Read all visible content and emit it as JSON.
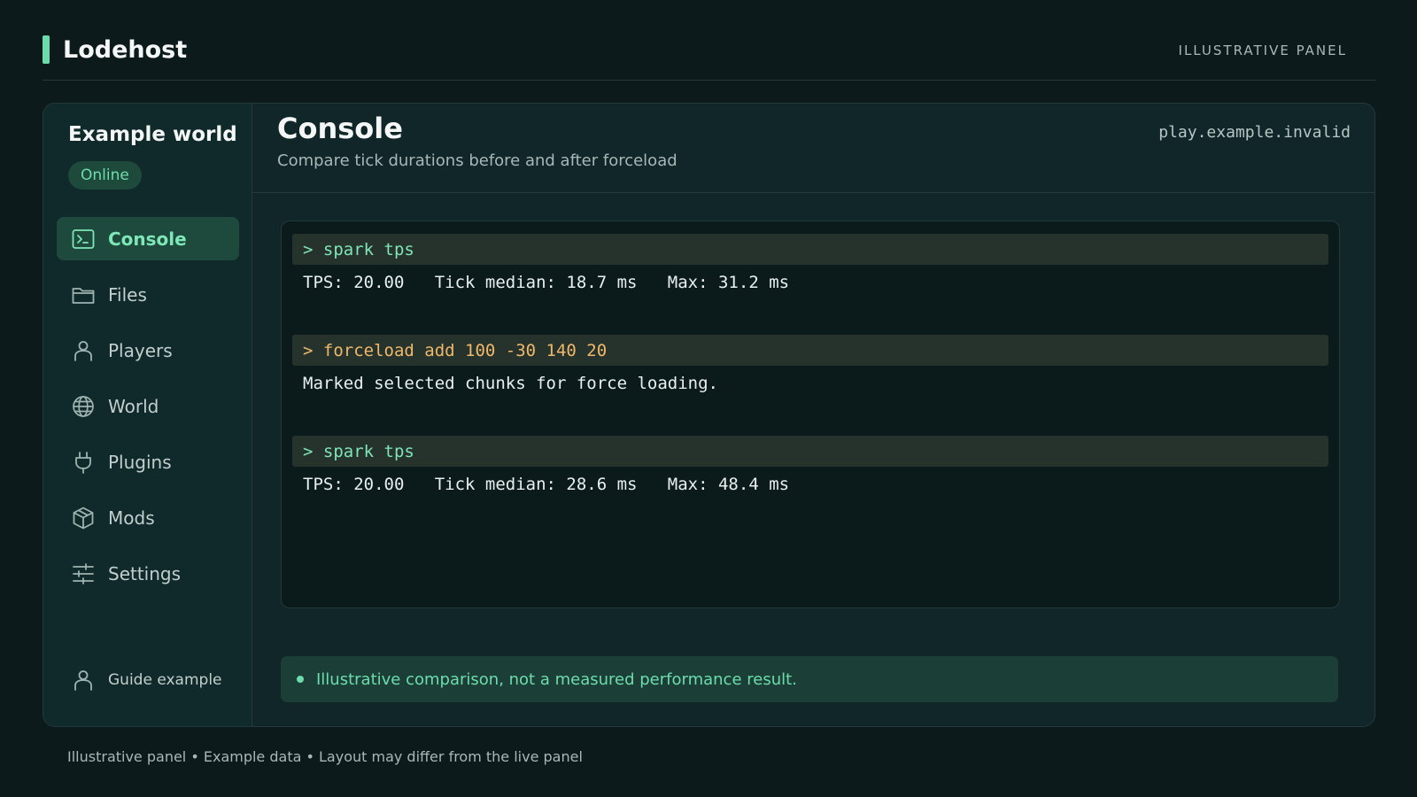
{
  "app": {
    "brand": "Lodehost",
    "top_label": "ILLUSTRATIVE PANEL"
  },
  "sidebar": {
    "world_title": "Example world",
    "status": "Online",
    "items": [
      {
        "label": "Console",
        "icon": "terminal-icon",
        "active": true
      },
      {
        "label": "Files",
        "icon": "folder-icon",
        "active": false
      },
      {
        "label": "Players",
        "icon": "person-icon",
        "active": false
      },
      {
        "label": "World",
        "icon": "globe-icon",
        "active": false
      },
      {
        "label": "Plugins",
        "icon": "plug-icon",
        "active": false
      },
      {
        "label": "Mods",
        "icon": "box-icon",
        "active": false
      },
      {
        "label": "Settings",
        "icon": "sliders-icon",
        "active": false
      }
    ],
    "footer_user": "Guide example"
  },
  "main": {
    "title": "Console",
    "subtitle": "Compare tick durations before and after forceload",
    "server_address": "play.example.invalid",
    "console_lines": [
      {
        "type": "command",
        "text": "> spark tps",
        "tone": "green"
      },
      {
        "type": "output",
        "text": "TPS: 20.00   Tick median: 18.7 ms   Max: 31.2 ms"
      },
      {
        "type": "command",
        "text": "> forceload add 100 -30 140 20",
        "tone": "orange"
      },
      {
        "type": "output",
        "text": "Marked selected chunks for force loading."
      },
      {
        "type": "command",
        "text": "> spark tps",
        "tone": "green"
      },
      {
        "type": "output",
        "text": "TPS: 20.00   Tick median: 28.6 ms   Max: 48.4 ms"
      }
    ],
    "notice": "Illustrative comparison, not a measured performance result."
  },
  "footer": {
    "note": "Illustrative panel • Example data • Layout may differ from the live panel"
  },
  "colors": {
    "accent": "#6ddcad",
    "background": "#0c1a1b",
    "warning": "#f0b86a"
  }
}
